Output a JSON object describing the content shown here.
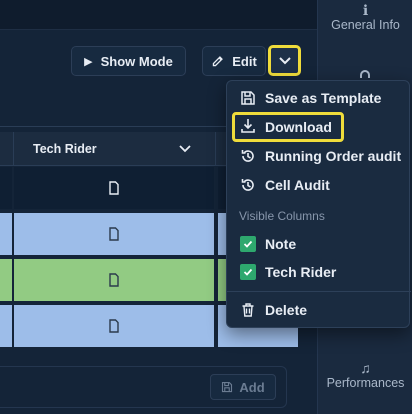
{
  "sidebar": {
    "general_info": {
      "label": "General Info",
      "icon": "info-icon"
    },
    "performances": {
      "label": "Performances",
      "icon": "music-note-icon"
    }
  },
  "toolbar": {
    "show_mode_label": "Show Mode",
    "edit_label": "Edit",
    "more_icon": "chevron-down-icon"
  },
  "table": {
    "column_header": "Tech Rider",
    "rows": [
      {
        "color": "#0f1f33"
      },
      {
        "color": "#9dbde9"
      },
      {
        "color": "#92cb83"
      },
      {
        "color": "#9dbde9"
      }
    ]
  },
  "footer": {
    "add_label": "Add"
  },
  "menu": {
    "items": [
      {
        "label": "Save as Template",
        "icon": "save-icon"
      },
      {
        "label": "Download",
        "icon": "download-icon"
      },
      {
        "label": "Running Order audit",
        "icon": "history-icon"
      },
      {
        "label": "Cell Audit",
        "icon": "history-icon"
      }
    ],
    "section_label": "Visible Columns",
    "columns": [
      {
        "label": "Note",
        "checked": true
      },
      {
        "label": "Tech Rider",
        "checked": true
      }
    ],
    "delete_label": "Delete"
  },
  "colors": {
    "highlight": "#efdc3b",
    "check": "#2ea86e",
    "row_blue": "#9dbde9",
    "row_green": "#92cb83"
  }
}
